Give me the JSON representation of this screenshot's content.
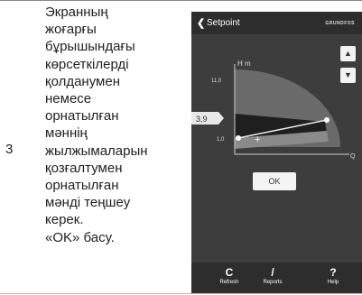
{
  "step": {
    "number": "3",
    "lines": [
      "Экранның",
      "жоғарғы",
      "бұрышындағы",
      "көрсеткілерді",
      "қолданумен",
      "немесе",
      "орнатылған",
      "мәннің",
      "жылжымаларын",
      "қозғалтумен",
      "орнатылған",
      "мәнді теңшеу",
      "керек.",
      "«OK» басу."
    ]
  },
  "app": {
    "back_icon": "chevron-left-icon",
    "title": "Setpoint",
    "brand": "GRUNDFOS",
    "up_icon": "chevron-up-icon",
    "down_icon": "chevron-down-icon",
    "chart": {
      "h_axis_label": "H m",
      "q_axis_label": "Q",
      "max_label": "11,0",
      "min_label": "1,0",
      "setpoint_value": "3,9",
      "plus_icon": "plus-icon"
    },
    "ok_label": "OK",
    "footer": [
      {
        "label": "Refresh",
        "icon": "refresh-icon",
        "glyph": "C"
      },
      {
        "label": "Reports",
        "icon": "pencil-icon",
        "glyph": "/"
      },
      {
        "label": "Help",
        "icon": "question-icon",
        "glyph": "?"
      }
    ],
    "colors": {
      "background": "#3d3d3d",
      "header": "#2d2d2d",
      "setpoint_marker": "#e8e8e8"
    }
  }
}
